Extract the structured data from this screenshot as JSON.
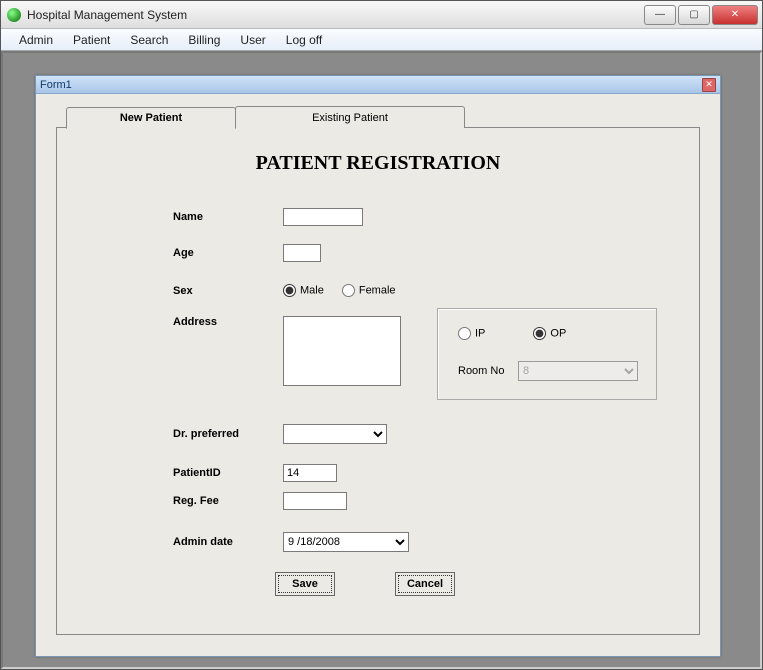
{
  "window": {
    "title": "Hospital Management System",
    "controls": {
      "min": "—",
      "max": "▢",
      "close": "✕"
    }
  },
  "menu": {
    "items": [
      "Admin",
      "Patient",
      "Search",
      "Billing",
      "User",
      "Log off"
    ]
  },
  "child": {
    "title": "Form1",
    "close": "✕"
  },
  "tabs": {
    "new": "New Patient",
    "existing": "Existing Patient"
  },
  "form": {
    "heading": "PATIENT REGISTRATION",
    "labels": {
      "name": "Name",
      "age": "Age",
      "sex": "Sex",
      "address": "Address",
      "drpref": "Dr. preferred",
      "patientid": "PatientID",
      "regfee": "Reg. Fee",
      "admindate": "Admin date",
      "roomno": "Room No"
    },
    "values": {
      "name": "",
      "age": "",
      "sex": "Male",
      "address": "",
      "drpref": "",
      "patientid": "14",
      "regfee": "",
      "admindate": "9 /18/2008",
      "roomno": "8"
    },
    "sex_options": {
      "male": "Male",
      "female": "Female"
    },
    "type_options": {
      "ip": "IP",
      "op": "OP"
    },
    "type_selected": "OP",
    "buttons": {
      "save": "Save",
      "cancel": "Cancel"
    }
  }
}
